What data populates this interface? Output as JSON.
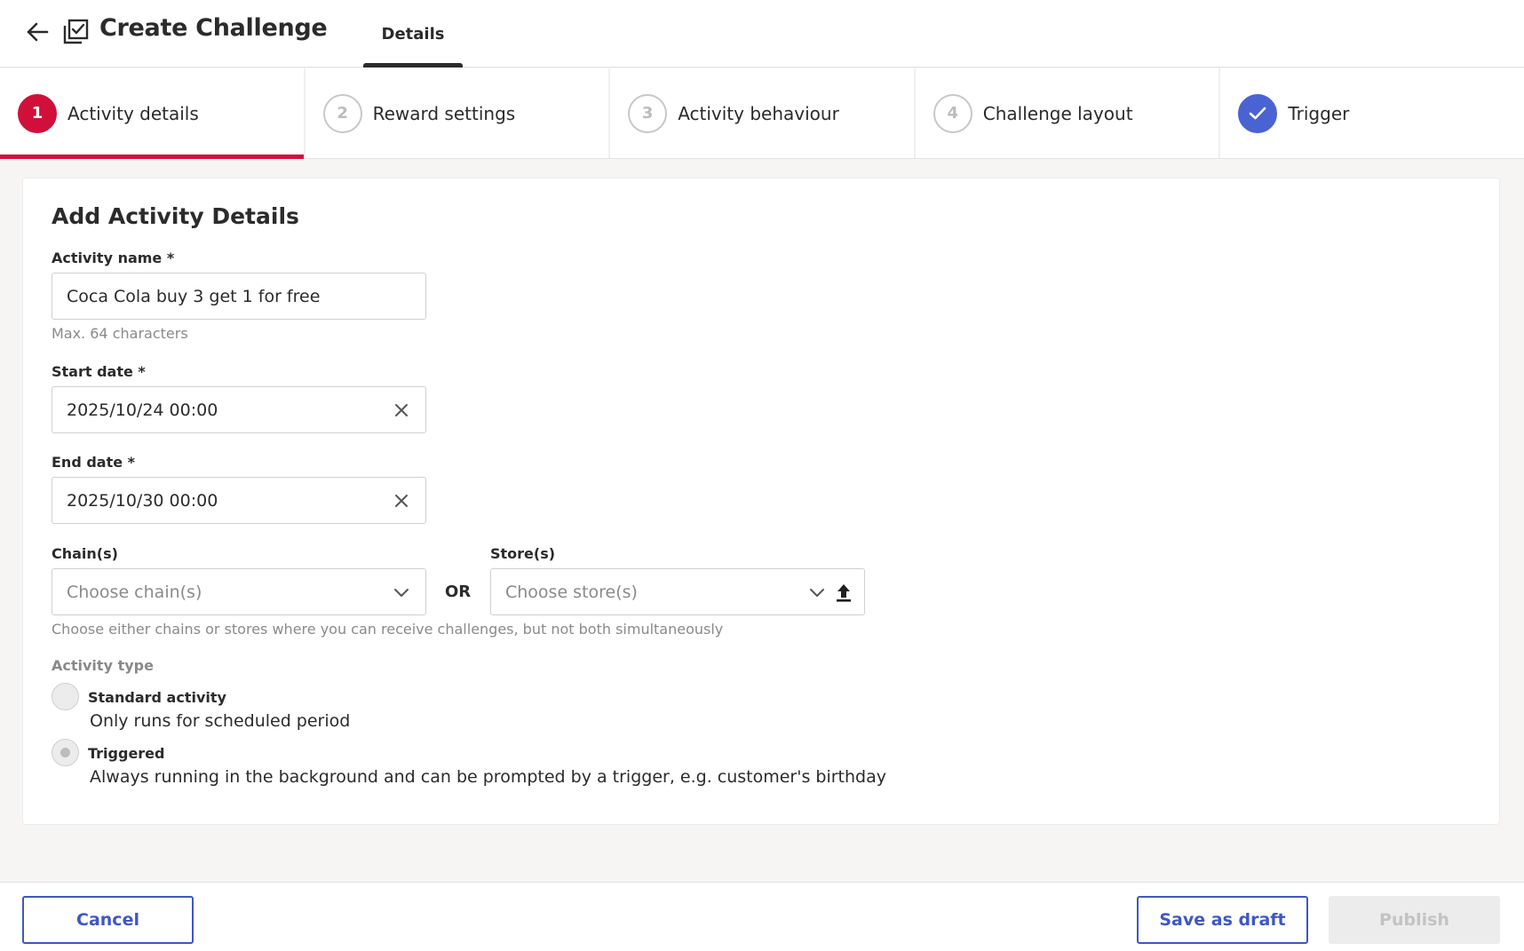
{
  "header": {
    "title": "Create Challenge",
    "tab_label": "Details"
  },
  "stepper": {
    "steps": [
      {
        "marker": "1",
        "label": "Activity details",
        "state": "active"
      },
      {
        "marker": "2",
        "label": "Reward settings",
        "state": "pending"
      },
      {
        "marker": "3",
        "label": "Activity behaviour",
        "state": "pending"
      },
      {
        "marker": "4",
        "label": "Challenge layout",
        "state": "pending"
      },
      {
        "marker": "check-icon",
        "label": "Trigger",
        "state": "done"
      }
    ]
  },
  "form": {
    "title": "Add Activity Details",
    "activity_name": {
      "label": "Activity name *",
      "value": "Coca Cola buy 3 get 1 for free",
      "helper": "Max. 64 characters"
    },
    "start_date": {
      "label": "Start date *",
      "value": "2025/10/24 00:00"
    },
    "end_date": {
      "label": "End date *",
      "value": "2025/10/30 00:00"
    },
    "chains": {
      "label": "Chain(s)",
      "placeholder": "Choose chain(s)"
    },
    "or_label": "OR",
    "stores": {
      "label": "Store(s)",
      "placeholder": "Choose store(s)"
    },
    "location_helper": "Choose either chains or stores where you can receive challenges, but not both simultaneously",
    "activity_type": {
      "label": "Activity type",
      "options": [
        {
          "title": "Standard activity",
          "description": "Only runs for scheduled period",
          "selected": false
        },
        {
          "title": "Triggered",
          "description": "Always running in the background and can be prompted by a trigger, e.g. customer's birthday",
          "selected": true
        }
      ]
    }
  },
  "footer": {
    "cancel_label": "Cancel",
    "save_draft_label": "Save as draft",
    "publish_label": "Publish"
  },
  "colors": {
    "active_step": "#d0103a",
    "done_step": "#4a63d3",
    "primary_outline": "#3f57c4"
  }
}
